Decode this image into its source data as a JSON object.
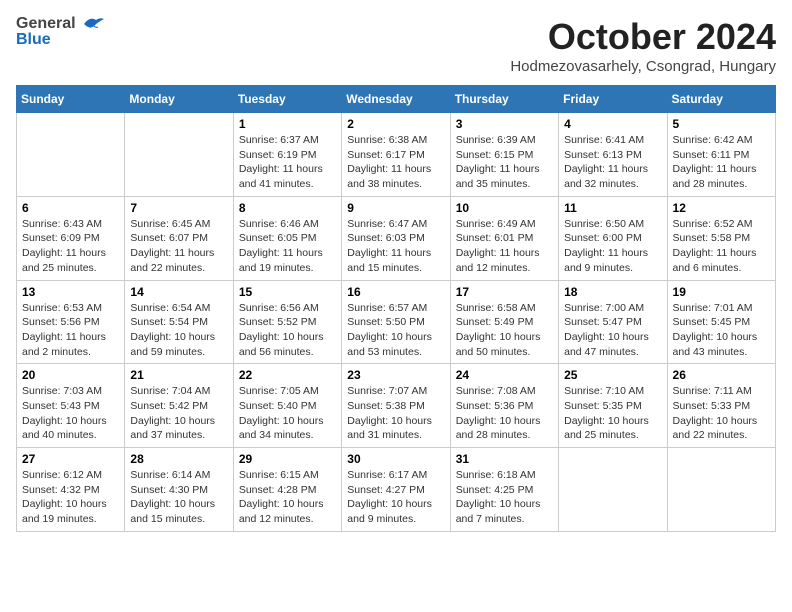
{
  "header": {
    "logo_general": "General",
    "logo_blue": "Blue",
    "title": "October 2024",
    "subtitle": "Hodmezovasarhely, Csongrad, Hungary"
  },
  "calendar": {
    "days_of_week": [
      "Sunday",
      "Monday",
      "Tuesday",
      "Wednesday",
      "Thursday",
      "Friday",
      "Saturday"
    ],
    "weeks": [
      [
        {
          "day": "",
          "info": ""
        },
        {
          "day": "",
          "info": ""
        },
        {
          "day": "1",
          "info": "Sunrise: 6:37 AM\nSunset: 6:19 PM\nDaylight: 11 hours and 41 minutes."
        },
        {
          "day": "2",
          "info": "Sunrise: 6:38 AM\nSunset: 6:17 PM\nDaylight: 11 hours and 38 minutes."
        },
        {
          "day": "3",
          "info": "Sunrise: 6:39 AM\nSunset: 6:15 PM\nDaylight: 11 hours and 35 minutes."
        },
        {
          "day": "4",
          "info": "Sunrise: 6:41 AM\nSunset: 6:13 PM\nDaylight: 11 hours and 32 minutes."
        },
        {
          "day": "5",
          "info": "Sunrise: 6:42 AM\nSunset: 6:11 PM\nDaylight: 11 hours and 28 minutes."
        }
      ],
      [
        {
          "day": "6",
          "info": "Sunrise: 6:43 AM\nSunset: 6:09 PM\nDaylight: 11 hours and 25 minutes."
        },
        {
          "day": "7",
          "info": "Sunrise: 6:45 AM\nSunset: 6:07 PM\nDaylight: 11 hours and 22 minutes."
        },
        {
          "day": "8",
          "info": "Sunrise: 6:46 AM\nSunset: 6:05 PM\nDaylight: 11 hours and 19 minutes."
        },
        {
          "day": "9",
          "info": "Sunrise: 6:47 AM\nSunset: 6:03 PM\nDaylight: 11 hours and 15 minutes."
        },
        {
          "day": "10",
          "info": "Sunrise: 6:49 AM\nSunset: 6:01 PM\nDaylight: 11 hours and 12 minutes."
        },
        {
          "day": "11",
          "info": "Sunrise: 6:50 AM\nSunset: 6:00 PM\nDaylight: 11 hours and 9 minutes."
        },
        {
          "day": "12",
          "info": "Sunrise: 6:52 AM\nSunset: 5:58 PM\nDaylight: 11 hours and 6 minutes."
        }
      ],
      [
        {
          "day": "13",
          "info": "Sunrise: 6:53 AM\nSunset: 5:56 PM\nDaylight: 11 hours and 2 minutes."
        },
        {
          "day": "14",
          "info": "Sunrise: 6:54 AM\nSunset: 5:54 PM\nDaylight: 10 hours and 59 minutes."
        },
        {
          "day": "15",
          "info": "Sunrise: 6:56 AM\nSunset: 5:52 PM\nDaylight: 10 hours and 56 minutes."
        },
        {
          "day": "16",
          "info": "Sunrise: 6:57 AM\nSunset: 5:50 PM\nDaylight: 10 hours and 53 minutes."
        },
        {
          "day": "17",
          "info": "Sunrise: 6:58 AM\nSunset: 5:49 PM\nDaylight: 10 hours and 50 minutes."
        },
        {
          "day": "18",
          "info": "Sunrise: 7:00 AM\nSunset: 5:47 PM\nDaylight: 10 hours and 47 minutes."
        },
        {
          "day": "19",
          "info": "Sunrise: 7:01 AM\nSunset: 5:45 PM\nDaylight: 10 hours and 43 minutes."
        }
      ],
      [
        {
          "day": "20",
          "info": "Sunrise: 7:03 AM\nSunset: 5:43 PM\nDaylight: 10 hours and 40 minutes."
        },
        {
          "day": "21",
          "info": "Sunrise: 7:04 AM\nSunset: 5:42 PM\nDaylight: 10 hours and 37 minutes."
        },
        {
          "day": "22",
          "info": "Sunrise: 7:05 AM\nSunset: 5:40 PM\nDaylight: 10 hours and 34 minutes."
        },
        {
          "day": "23",
          "info": "Sunrise: 7:07 AM\nSunset: 5:38 PM\nDaylight: 10 hours and 31 minutes."
        },
        {
          "day": "24",
          "info": "Sunrise: 7:08 AM\nSunset: 5:36 PM\nDaylight: 10 hours and 28 minutes."
        },
        {
          "day": "25",
          "info": "Sunrise: 7:10 AM\nSunset: 5:35 PM\nDaylight: 10 hours and 25 minutes."
        },
        {
          "day": "26",
          "info": "Sunrise: 7:11 AM\nSunset: 5:33 PM\nDaylight: 10 hours and 22 minutes."
        }
      ],
      [
        {
          "day": "27",
          "info": "Sunrise: 6:12 AM\nSunset: 4:32 PM\nDaylight: 10 hours and 19 minutes."
        },
        {
          "day": "28",
          "info": "Sunrise: 6:14 AM\nSunset: 4:30 PM\nDaylight: 10 hours and 15 minutes."
        },
        {
          "day": "29",
          "info": "Sunrise: 6:15 AM\nSunset: 4:28 PM\nDaylight: 10 hours and 12 minutes."
        },
        {
          "day": "30",
          "info": "Sunrise: 6:17 AM\nSunset: 4:27 PM\nDaylight: 10 hours and 9 minutes."
        },
        {
          "day": "31",
          "info": "Sunrise: 6:18 AM\nSunset: 4:25 PM\nDaylight: 10 hours and 7 minutes."
        },
        {
          "day": "",
          "info": ""
        },
        {
          "day": "",
          "info": ""
        }
      ]
    ]
  }
}
